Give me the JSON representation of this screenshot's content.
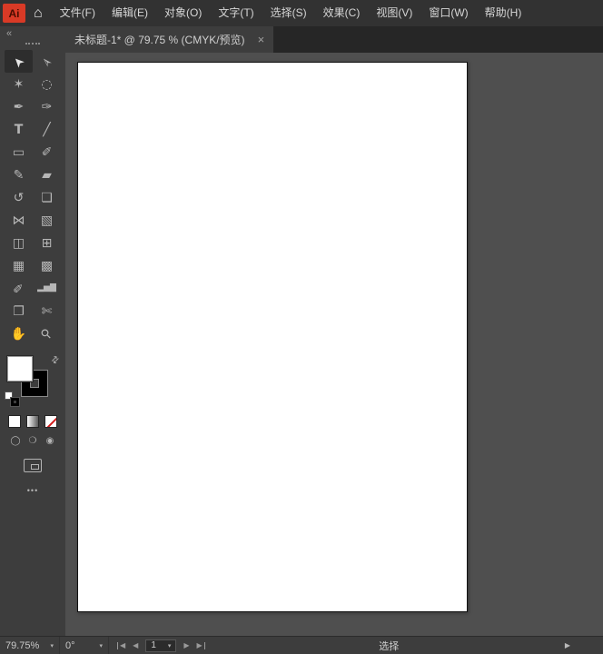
{
  "app": {
    "logo_text": "Ai"
  },
  "colors": {
    "menu_bg": "#323232",
    "panel_bg": "#3d3d3d",
    "tab_strip_bg": "#262626",
    "active_tab_bg": "#3d3d3d",
    "pasteboard": "#4f4f4f",
    "artboard": "#ffffff",
    "logo_bg": "#d93a26",
    "icon": "#b6b6b6",
    "none_slash": "#d41c1c"
  },
  "menu": {
    "items": [
      "文件(F)",
      "编辑(E)",
      "对象(O)",
      "文字(T)",
      "选择(S)",
      "效果(C)",
      "视图(V)",
      "窗口(W)",
      "帮助(H)"
    ]
  },
  "tab": {
    "title": "未标题-1* @ 79.75 % (CMYK/预览)"
  },
  "toolbar": {
    "tools": [
      {
        "name": "selection",
        "glyph": "➤",
        "rotate": -135,
        "selected": true
      },
      {
        "name": "direct-selection",
        "glyph": "➢",
        "rotate": -135
      },
      {
        "name": "magic-wand",
        "glyph": "✶"
      },
      {
        "name": "lasso",
        "glyph": "◌"
      },
      {
        "name": "pen",
        "glyph": "✒"
      },
      {
        "name": "curvature",
        "glyph": "✑"
      },
      {
        "name": "type",
        "glyph": "T",
        "bold": true
      },
      {
        "name": "line-segment",
        "glyph": "╱"
      },
      {
        "name": "rectangle",
        "glyph": "▭"
      },
      {
        "name": "paintbrush",
        "glyph": "✐"
      },
      {
        "name": "pencil",
        "glyph": "✎"
      },
      {
        "name": "eraser",
        "glyph": "▰"
      },
      {
        "name": "rotate",
        "glyph": "↺"
      },
      {
        "name": "scale",
        "glyph": "❏"
      },
      {
        "name": "width",
        "glyph": "⋈"
      },
      {
        "name": "free-transform",
        "glyph": "▧"
      },
      {
        "name": "shape-builder",
        "glyph": "◫"
      },
      {
        "name": "perspective-grid",
        "glyph": "⊞"
      },
      {
        "name": "mesh",
        "glyph": "▦"
      },
      {
        "name": "gradient",
        "glyph": "▩"
      },
      {
        "name": "eyedropper",
        "glyph": "✏",
        "rotate": -45
      },
      {
        "name": "column-graph",
        "glyph": "▂▅▇",
        "size": 9
      },
      {
        "name": "artboard",
        "glyph": "❐"
      },
      {
        "name": "slice",
        "glyph": "✄"
      },
      {
        "name": "hand",
        "glyph": "✋"
      },
      {
        "name": "zoom",
        "glyph": "⚲",
        "rotate": -45
      }
    ],
    "draw_modes": [
      {
        "name": "draw-normal",
        "glyph": "◯"
      },
      {
        "name": "draw-behind",
        "glyph": "❍"
      },
      {
        "name": "draw-inside",
        "glyph": "◉"
      }
    ]
  },
  "swatches": {
    "fill": "#ffffff",
    "stroke": "#000000"
  },
  "statusbar": {
    "zoom": "79.75%",
    "rotation": "0°",
    "artboard_number": "1",
    "status": "选择"
  },
  "icons": {
    "home": "⌂",
    "collapse": "«",
    "close": "×",
    "swap": "⇄",
    "chevron": "▾",
    "first": "◀",
    "prev": "◀",
    "next": "▶",
    "last": "▶",
    "expand": "▶",
    "ellipsis": "•••"
  }
}
